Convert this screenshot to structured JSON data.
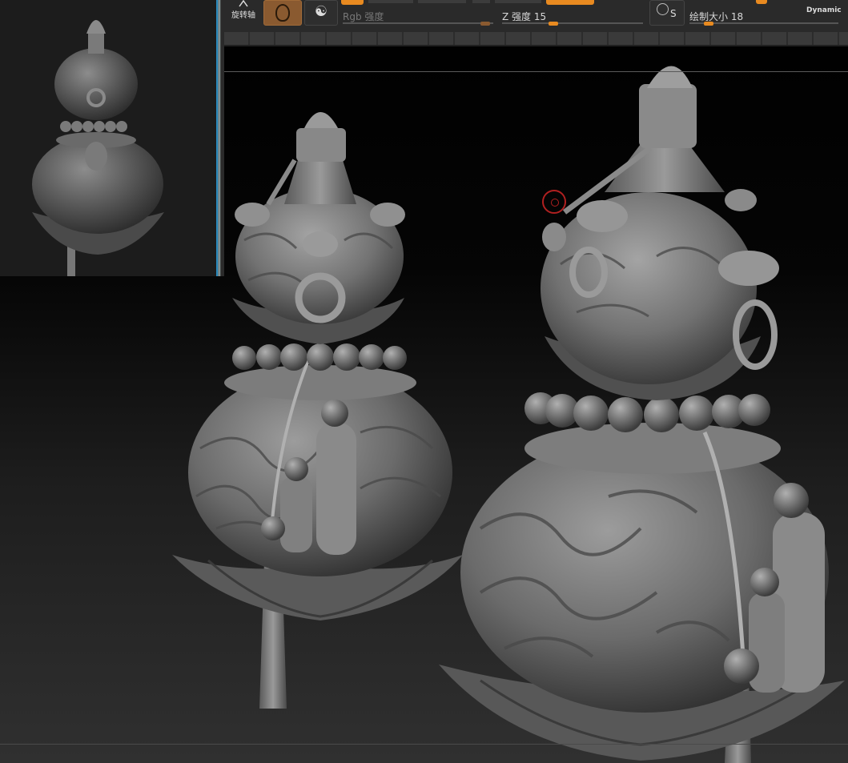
{
  "toolbar": {
    "rotate_label": "旋转轴",
    "rgb_intensity_label": "Rgb 强度",
    "z_intensity_label": "Z 强度",
    "z_intensity_value": "15",
    "s_label": "S",
    "draw_size_label": "绘制大小",
    "draw_size_value": "18",
    "dynamic_label": "Dynamic",
    "accent_color": "#e88a20",
    "material_color": "#8a5a30"
  },
  "icons": {
    "rotate": "rotate-axis-icon",
    "material": "material-sphere-icon",
    "swirl": "texture-swirl-icon",
    "stroke": "stroke-s-icon",
    "cursor": "brush-cursor-icon"
  },
  "viewport": {
    "subject": "gourd sculpture",
    "cursor_color": "#b02020"
  }
}
